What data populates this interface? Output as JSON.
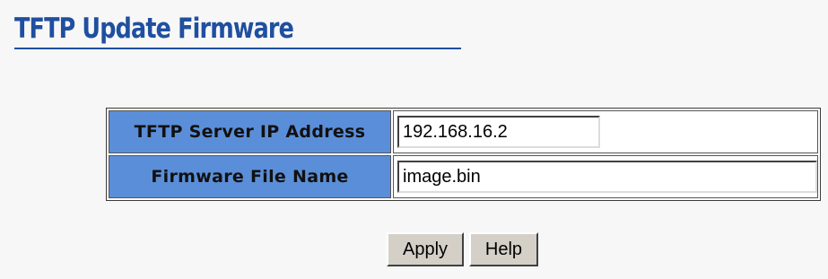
{
  "page": {
    "title": "TFTP Update Firmware"
  },
  "form": {
    "server_ip_label": "TFTP Server IP Address",
    "server_ip_value": "192.168.16.2",
    "file_name_label": "Firmware File Name",
    "file_name_value": "image.bin"
  },
  "buttons": {
    "apply_label": "Apply",
    "help_label": "Help"
  },
  "colors": {
    "title": "#1f4fa0",
    "label_cell_background": "#5b8ed8",
    "button_face": "#d4d0c8",
    "page_background": "#f7f7f7"
  }
}
